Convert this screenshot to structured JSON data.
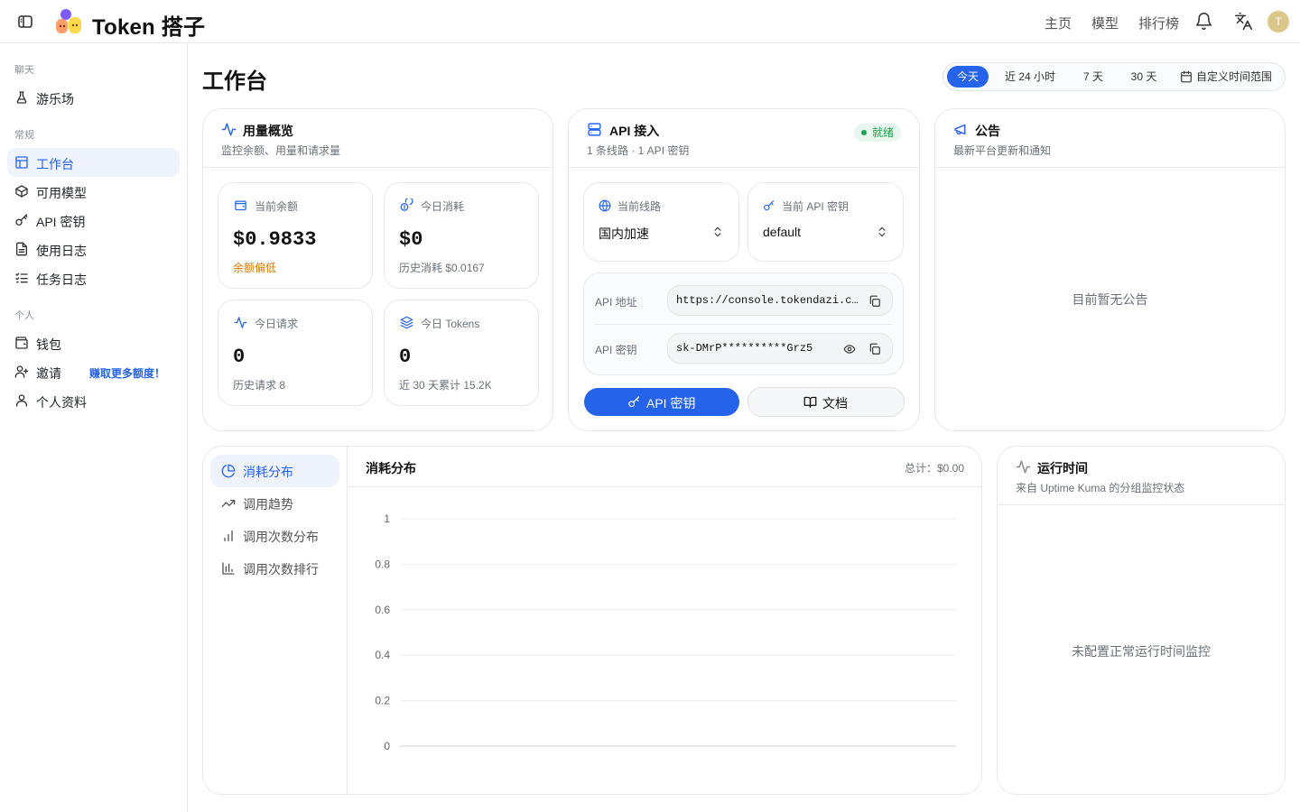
{
  "app": {
    "brand": "Token 搭子"
  },
  "topnav": {
    "links": [
      "主页",
      "模型",
      "排行榜"
    ],
    "avatar_letter": "T"
  },
  "sidebar": {
    "sections": [
      {
        "title": "聊天",
        "items": [
          {
            "label": "游乐场",
            "icon": "flask-icon"
          }
        ]
      },
      {
        "title": "常规",
        "items": [
          {
            "label": "工作台",
            "icon": "dashboard-icon",
            "active": true
          },
          {
            "label": "可用模型",
            "icon": "cube-icon"
          },
          {
            "label": "API 密钥",
            "icon": "key-icon"
          },
          {
            "label": "使用日志",
            "icon": "log-icon"
          },
          {
            "label": "任务日志",
            "icon": "list-checks-icon"
          }
        ]
      },
      {
        "title": "个人",
        "items": [
          {
            "label": "钱包",
            "icon": "wallet-icon"
          },
          {
            "label": "邀请",
            "icon": "user-plus-icon",
            "extra": "赚取更多额度！"
          },
          {
            "label": "个人资料",
            "icon": "user-icon"
          }
        ]
      }
    ]
  },
  "page": {
    "title": "工作台"
  },
  "time_range": {
    "options": [
      "今天",
      "近 24 小时",
      "7 天",
      "30 天"
    ],
    "custom": "自定义时间范围",
    "selected": "今天"
  },
  "usage": {
    "title": "用量概览",
    "subtitle": "监控余额、用量和请求量",
    "stats": [
      {
        "label": "当前余额",
        "value": "$0.9833",
        "note": "余额偏低",
        "icon": "wallet-icon",
        "warn": true
      },
      {
        "label": "今日消耗",
        "value": "$0",
        "note": "历史消耗 $0.0167",
        "icon": "coins-icon"
      },
      {
        "label": "今日请求",
        "value": "0",
        "note": "历史请求 8",
        "icon": "activity-icon"
      },
      {
        "label": "今日 Tokens",
        "value": "0",
        "note": "近 30 天累计 15.2K",
        "icon": "layers-icon"
      }
    ]
  },
  "api": {
    "title": "API 接入",
    "subtitle": "1 条线路 · 1 API 密钥",
    "status": "就绪",
    "route": {
      "label": "当前线路",
      "value": "国内加速"
    },
    "key_select": {
      "label": "当前 API 密钥",
      "value": "default"
    },
    "address": {
      "label": "API 地址",
      "value": "https://console.tokendazi.com"
    },
    "key": {
      "label": "API 密钥",
      "value": "sk-DMrP**********Grz5"
    },
    "primary_button": "API 密钥",
    "docs_button": "文档"
  },
  "announcements": {
    "title": "公告",
    "subtitle": "最新平台更新和通知",
    "empty": "目前暂无公告"
  },
  "analytics": {
    "tabs": [
      {
        "label": "消耗分布",
        "icon": "pie-chart-icon",
        "active": true
      },
      {
        "label": "调用趋势",
        "icon": "trending-up-icon"
      },
      {
        "label": "调用次数分布",
        "icon": "bar-chart-icon"
      },
      {
        "label": "调用次数排行",
        "icon": "bar-chart-ranking-icon"
      }
    ],
    "panel_title": "消耗分布",
    "total_label": "总计：",
    "total_value": "$0.00"
  },
  "chart_data": {
    "type": "bar",
    "categories": [],
    "series": [],
    "y_ticks": [
      0,
      0.2,
      0.4,
      0.6,
      0.8,
      1
    ],
    "ylim": [
      0,
      1
    ],
    "grid": true
  },
  "uptime": {
    "title": "运行时间",
    "subtitle": "来自 Uptime Kuma 的分组监控状态",
    "empty": "未配置正常运行时间监控"
  },
  "colors": {
    "accent": "#2563eb",
    "warning": "#d97706",
    "success": "#16a34a"
  }
}
